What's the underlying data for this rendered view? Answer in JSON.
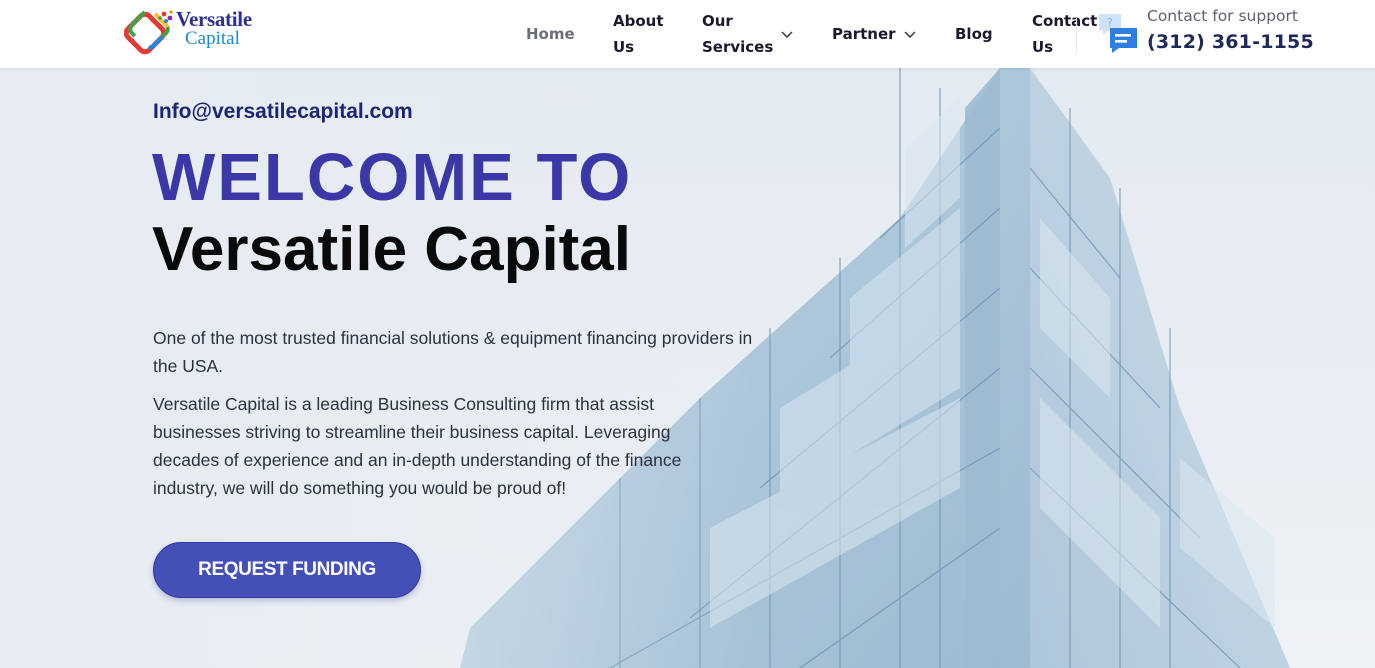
{
  "header": {
    "logo": {
      "line1": "Versatile",
      "line2": "Capital"
    },
    "nav": [
      {
        "label": "Home"
      },
      {
        "label_line1": "About",
        "label_line2": "Us"
      },
      {
        "label_line1": "Our",
        "label_line2": "Services"
      },
      {
        "label": "Partner"
      },
      {
        "label": "Blog"
      },
      {
        "label_line1": "Contact",
        "label_line2": "Us"
      }
    ],
    "support": {
      "label": "Contact for support",
      "phone": "(312) 361-1155",
      "icon": "chat-support-icon"
    }
  },
  "hero": {
    "email": "Info@versatilecapital.com",
    "headline": "WELCOME TO",
    "brand": "Versatile Capital",
    "intro": "One of the most trusted financial solutions & equipment financing providers in the USA.",
    "description": "Versatile Capital is a leading Business Consulting firm that assist businesses striving to streamline their  business capital. Leveraging decades of experience and an in-depth understanding of the finance industry, we will do something you would be proud of!",
    "cta_label": "REQUEST FUNDING",
    "background_image": "glass-skyscraper-photo"
  },
  "colors": {
    "headline": "#3a38a6",
    "email": "#1c2677",
    "cta": "#4450b8",
    "phone": "#1e2a5a",
    "support_icon": "#2f7fe0"
  }
}
